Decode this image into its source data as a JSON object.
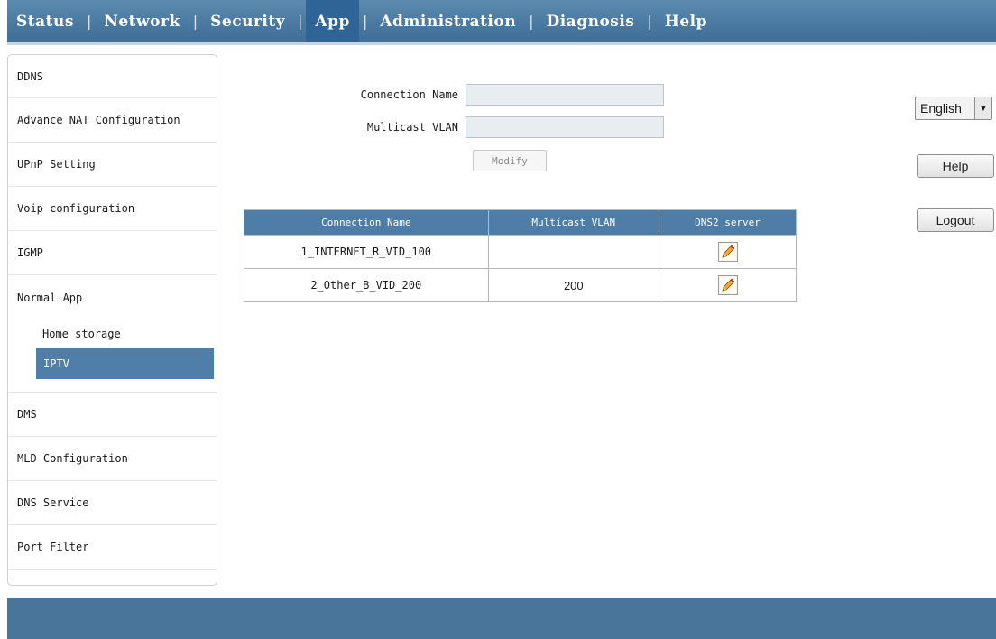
{
  "nav": {
    "items": [
      {
        "label": "Status",
        "active": false
      },
      {
        "label": "Network",
        "active": false
      },
      {
        "label": "Security",
        "active": false
      },
      {
        "label": "App",
        "active": true
      },
      {
        "label": "Administration",
        "active": false
      },
      {
        "label": "Diagnosis",
        "active": false
      },
      {
        "label": "Help",
        "active": false
      }
    ],
    "separator": "|"
  },
  "sidebar": {
    "items": [
      "DDNS",
      "Advance NAT Configuration",
      "UPnP Setting",
      "Voip configuration",
      "IGMP",
      "Normal App",
      "DMS",
      "MLD Configuration",
      "DNS Service",
      "Port Filter"
    ],
    "subitems": [
      "Home storage",
      "IPTV"
    ],
    "selected_sub": "IPTV"
  },
  "form": {
    "connection_name_label": "Connection Name",
    "connection_name_value": "",
    "multicast_vlan_label": "Multicast VLAN",
    "multicast_vlan_value": "",
    "modify_label": "Modify"
  },
  "table": {
    "headers": [
      "Connection Name",
      "Multicast VLAN",
      "DNS2 server"
    ],
    "rows": [
      {
        "connection_name": "1_INTERNET_R_VID_100",
        "multicast_vlan": ""
      },
      {
        "connection_name": "2_Other_B_VID_200",
        "multicast_vlan": "200"
      }
    ]
  },
  "right": {
    "language": "English",
    "help_label": "Help",
    "logout_label": "Logout"
  },
  "icons": {
    "edit": "pencil-edit-icon",
    "dropdown": "chevron-down-icon"
  },
  "colors": {
    "nav_bg": "#4a7aa2",
    "nav_active": "#2f6497",
    "selected": "#4f7fa8",
    "table_header": "#4e7ea8",
    "footer": "#487599"
  }
}
